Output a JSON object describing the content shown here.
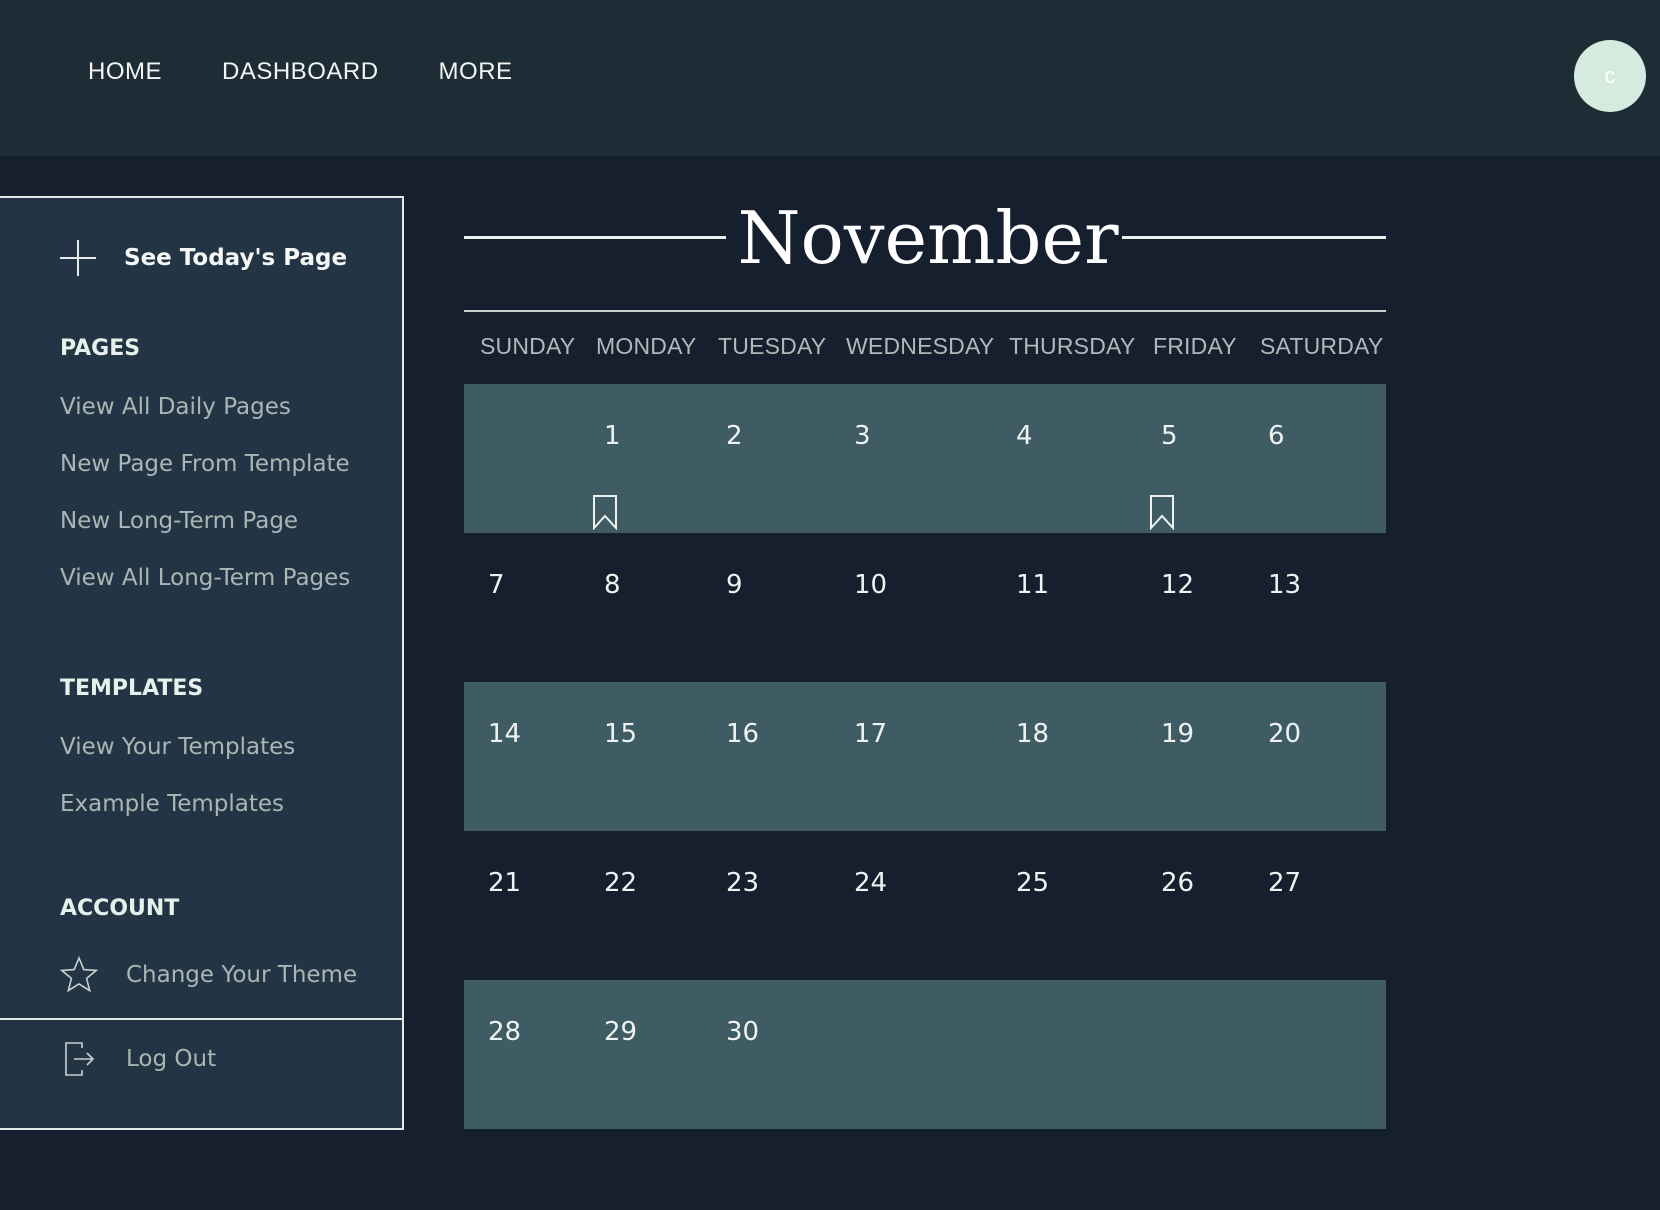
{
  "nav": {
    "items": [
      "HOME",
      "DASHBOARD",
      "MORE"
    ],
    "avatar_initial": "c"
  },
  "sidebar": {
    "today_label": "See Today's Page",
    "pages_title": "PAGES",
    "pages_links": [
      "View All Daily Pages",
      "New Page From Template",
      "New Long-Term Page",
      "View All Long-Term Pages"
    ],
    "templates_title": "TEMPLATES",
    "templates_links": [
      "View Your Templates",
      "Example Templates"
    ],
    "account_title": "ACCOUNT",
    "theme_label": "Change Your Theme",
    "logout_label": "Log Out"
  },
  "calendar": {
    "month": "November",
    "weekdays": [
      "SUNDAY",
      "MONDAY",
      "TUESDAY",
      "WEDNESDAY",
      "THURSDAY",
      "FRIDAY",
      "SATURDAY"
    ],
    "weeks": [
      [
        "",
        "1",
        "2",
        "3",
        "4",
        "5",
        "6"
      ],
      [
        "7",
        "8",
        "9",
        "10",
        "11",
        "12",
        "13"
      ],
      [
        "14",
        "15",
        "16",
        "17",
        "18",
        "19",
        "20"
      ],
      [
        "21",
        "22",
        "23",
        "24",
        "25",
        "26",
        "27"
      ],
      [
        "28",
        "29",
        "30",
        "",
        "",
        "",
        ""
      ]
    ],
    "bookmarked_days": [
      "1",
      "5"
    ]
  },
  "colors": {
    "topbar": "#1e2c35",
    "background": "#151f2e",
    "sidebar": "#233544",
    "week_band": "#3f5b63",
    "avatar": "#d6ebe0"
  }
}
